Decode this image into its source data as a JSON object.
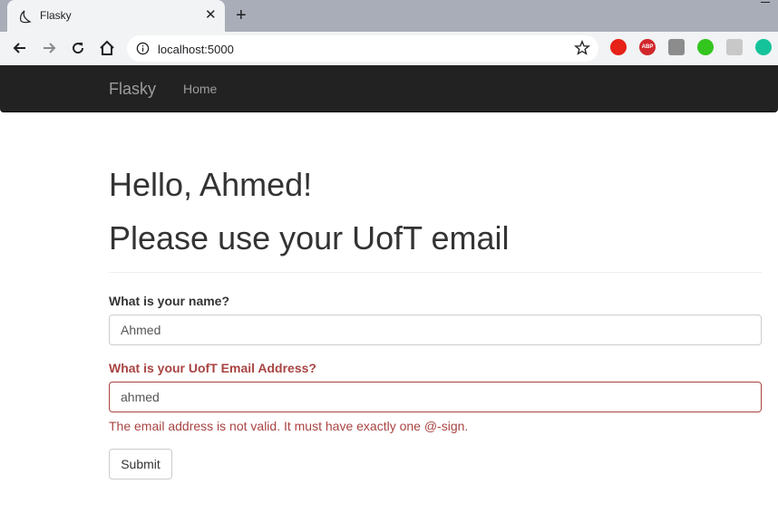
{
  "browser": {
    "tab_title": "Flasky",
    "tab_close": "✕",
    "new_tab": "+",
    "url": "localhost:5000",
    "extensions": [
      {
        "name": "youtube-ext-icon",
        "color": "#e62117"
      },
      {
        "name": "abp-ext-icon",
        "color": "#d1272c",
        "text": "ABP"
      },
      {
        "name": "drive-ext-icon",
        "color": "#8c8c8c"
      },
      {
        "name": "bitmoji-ext-icon",
        "color": "#34c51f"
      },
      {
        "name": "hashtag-ext-icon",
        "color": "#c8c8c8"
      },
      {
        "name": "grammarly-ext-icon",
        "color": "#15c39a"
      }
    ]
  },
  "navbar": {
    "brand": "Flasky",
    "home": "Home"
  },
  "page": {
    "greeting": "Hello, Ahmed!",
    "subheading": "Please use your UofT email",
    "form": {
      "name_label": "What is your name?",
      "name_value": "Ahmed",
      "email_label": "What is your UofT Email Address?",
      "email_value": "ahmed",
      "email_error": "The email address is not valid. It must have exactly one @-sign.",
      "submit_label": "Submit"
    }
  },
  "colors": {
    "navbar_bg": "#222222",
    "error": "#a94442"
  }
}
